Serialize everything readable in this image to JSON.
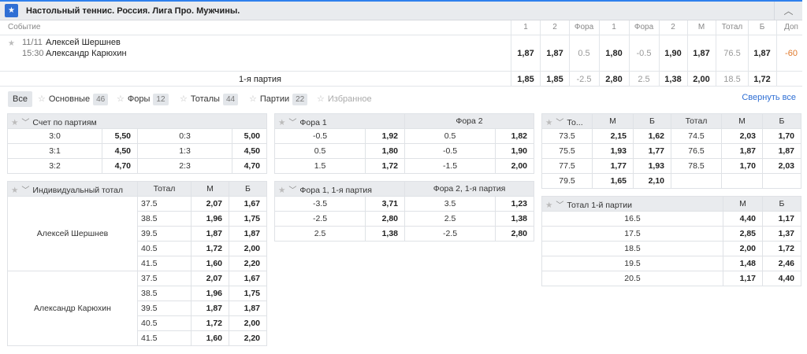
{
  "header": {
    "title": "Настольный теннис. Россия. Лига Про. Мужчины.",
    "collapse_icon": "chevron-up-icon"
  },
  "columns": {
    "event": "Событие",
    "c1": "1",
    "c2": "2",
    "fora1": "Фора",
    "c1b": "1",
    "fora2": "Фора",
    "c2b": "2",
    "m": "М",
    "total": "Тотал",
    "b": "Б",
    "dop": "Доп"
  },
  "event": {
    "date": "11/11",
    "time": "15:30",
    "player1": "Алексей Шершнев",
    "player2": "Александр Карюхин"
  },
  "main_row": {
    "v1": "1,87",
    "v2": "1,87",
    "fora1": "0.5",
    "f1": "1,80",
    "fora2": "-0.5",
    "f2": "1,90",
    "m": "1,87",
    "total": "76.5",
    "b": "1,87",
    "dop": "-60"
  },
  "set_row": {
    "label": "1-я партия",
    "v1": "1,85",
    "v2": "1,85",
    "fora1": "-2.5",
    "f1": "2,80",
    "fora2": "2.5",
    "f2": "1,38",
    "m": "2,00",
    "total": "18.5",
    "b": "1,72"
  },
  "tabs": {
    "all": "Все",
    "main": "Основные",
    "main_cnt": "46",
    "fory": "Форы",
    "fory_cnt": "12",
    "totals": "Тоталы",
    "totals_cnt": "44",
    "sets": "Партии",
    "sets_cnt": "22",
    "fav": "Избранное",
    "collapse_all": "Свернуть все"
  },
  "score": {
    "title": "Счет по партиям",
    "rows": [
      [
        "3:0",
        "5,50",
        "0:3",
        "5,00"
      ],
      [
        "3:1",
        "4,50",
        "1:3",
        "4,50"
      ],
      [
        "3:2",
        "4,70",
        "2:3",
        "4,70"
      ]
    ]
  },
  "indiv": {
    "title": "Индивидуальный тотал",
    "h_total": "Тотал",
    "h_m": "М",
    "h_b": "Б",
    "p1": "Алексей Шершнев",
    "p2": "Александр Карюхин",
    "rows1": [
      [
        "37.5",
        "2,07",
        "1,67"
      ],
      [
        "38.5",
        "1,96",
        "1,75"
      ],
      [
        "39.5",
        "1,87",
        "1,87"
      ],
      [
        "40.5",
        "1,72",
        "2,00"
      ],
      [
        "41.5",
        "1,60",
        "2,20"
      ]
    ],
    "rows2": [
      [
        "37.5",
        "2,07",
        "1,67"
      ],
      [
        "38.5",
        "1,96",
        "1,75"
      ],
      [
        "39.5",
        "1,87",
        "1,87"
      ],
      [
        "40.5",
        "1,72",
        "2,00"
      ],
      [
        "41.5",
        "1,60",
        "2,20"
      ]
    ]
  },
  "fora": {
    "h1": "Фора 1",
    "h2": "Фора 2",
    "rows": [
      [
        "-0.5",
        "1,92",
        "0.5",
        "1,82"
      ],
      [
        "0.5",
        "1,80",
        "-0.5",
        "1,90"
      ],
      [
        "1.5",
        "1,72",
        "-1.5",
        "2,00"
      ]
    ]
  },
  "fora_set": {
    "h1": "Фора 1, 1-я партия",
    "h2": "Фора 2, 1-я партия",
    "rows": [
      [
        "-3.5",
        "3,71",
        "3.5",
        "1,23"
      ],
      [
        "-2.5",
        "2,80",
        "2.5",
        "1,38"
      ],
      [
        "2.5",
        "1,38",
        "-2.5",
        "2,80"
      ]
    ]
  },
  "totals": {
    "h_to": "То...",
    "h_m": "М",
    "h_b": "Б",
    "h_total": "Тотал",
    "h_m2": "М",
    "h_b2": "Б",
    "rows": [
      [
        "73.5",
        "2,15",
        "1,62",
        "74.5",
        "2,03",
        "1,70"
      ],
      [
        "75.5",
        "1,93",
        "1,77",
        "76.5",
        "1,87",
        "1,87"
      ],
      [
        "77.5",
        "1,77",
        "1,93",
        "78.5",
        "1,70",
        "2,03"
      ],
      [
        "79.5",
        "1,65",
        "2,10",
        "",
        "",
        ""
      ]
    ]
  },
  "total_set": {
    "title": "Тотал 1-й партии",
    "h_m": "М",
    "h_b": "Б",
    "rows": [
      [
        "16.5",
        "4,40",
        "1,17"
      ],
      [
        "17.5",
        "2,85",
        "1,37"
      ],
      [
        "18.5",
        "2,00",
        "1,72"
      ],
      [
        "19.5",
        "1,48",
        "2,46"
      ],
      [
        "20.5",
        "1,17",
        "4,40"
      ]
    ]
  }
}
